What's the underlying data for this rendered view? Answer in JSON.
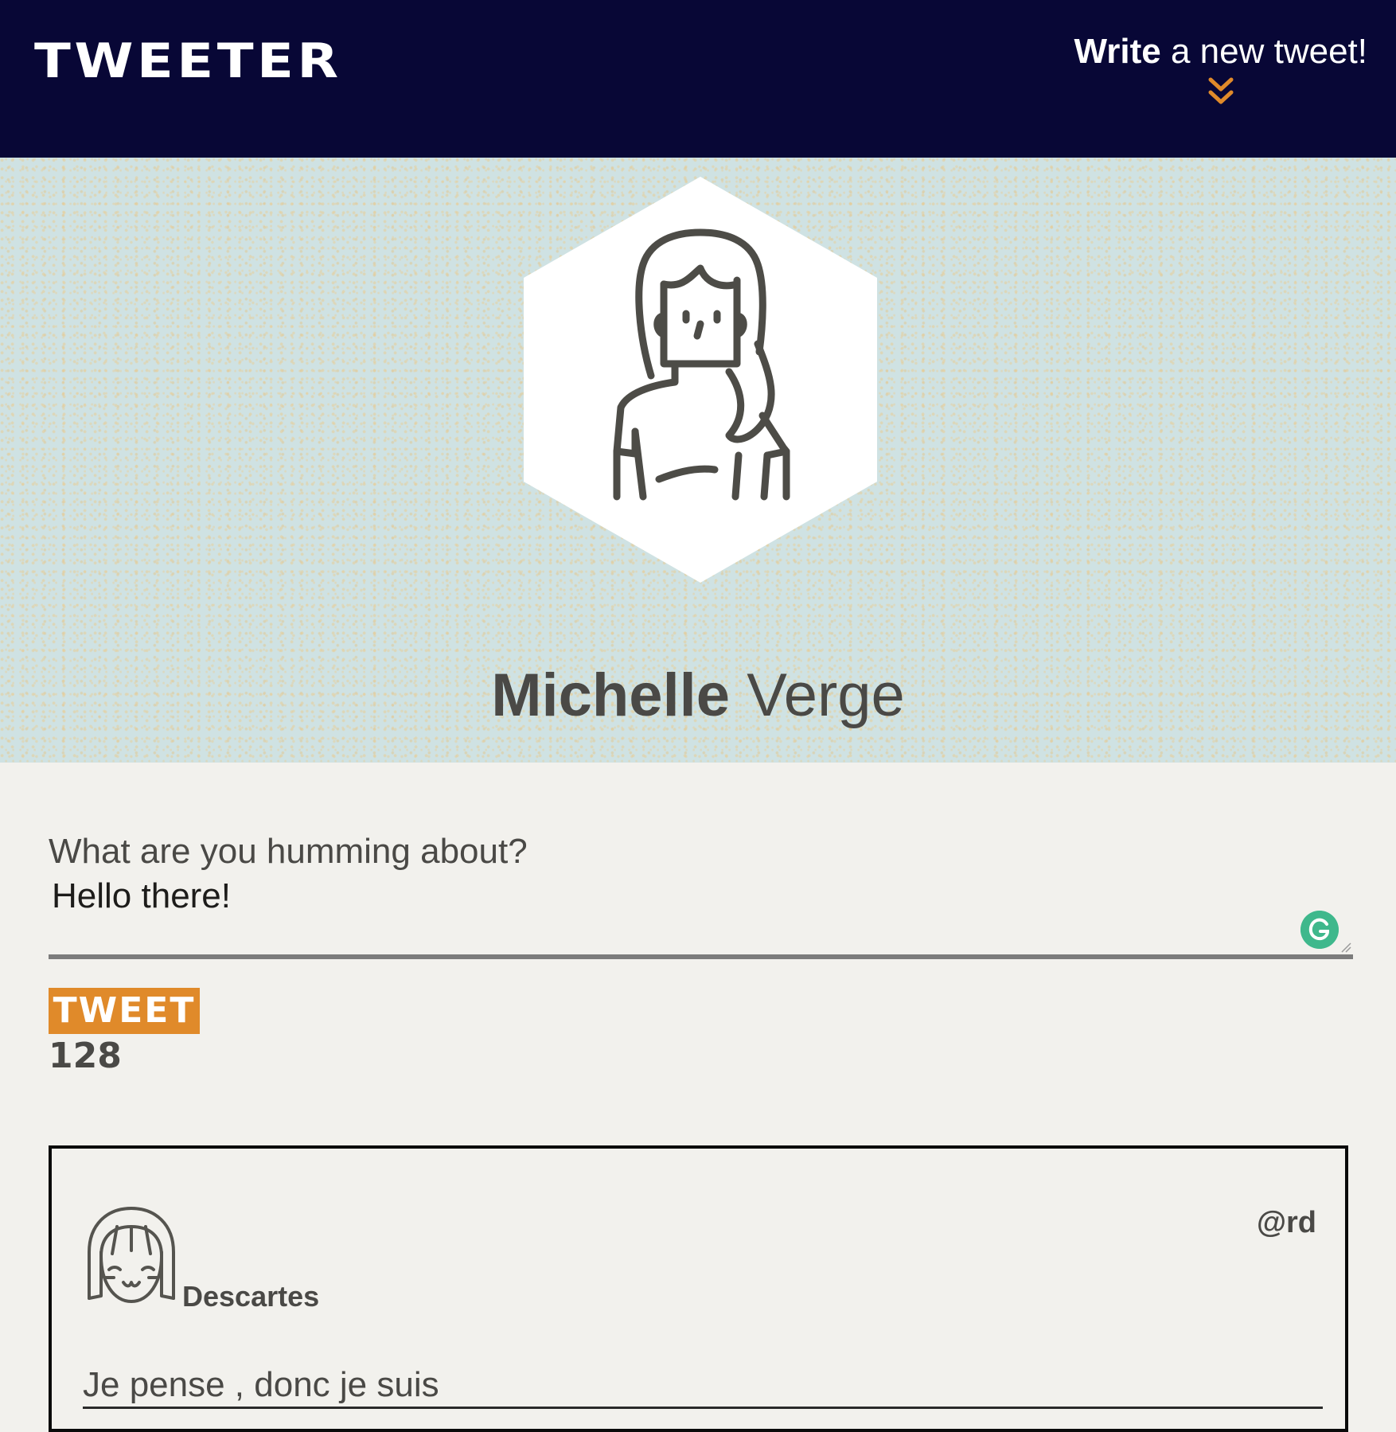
{
  "header": {
    "logo": "TWEETER",
    "compose_bold": "Write",
    "compose_rest": " a new tweet!",
    "compose_icon": "double-chevron-down-icon"
  },
  "profile": {
    "first_name": "Michelle",
    "last_name": " Verge",
    "avatar_icon": "woman-avatar-icon"
  },
  "composer": {
    "label": "What are you humming about?",
    "value": "Hello there!",
    "button_label": "TWEET",
    "char_count": "128"
  },
  "tweets": [
    {
      "author": "Descartes",
      "handle": "@rd",
      "body": "Je pense , donc je suis",
      "avatar_icon": "girl-avatar-icon"
    }
  ],
  "colors": {
    "navbar": "#080736",
    "accent": "#e08a2a",
    "banner": "#cfe2e3",
    "page_bg": "#f2f1ed",
    "text": "#4a4946"
  }
}
